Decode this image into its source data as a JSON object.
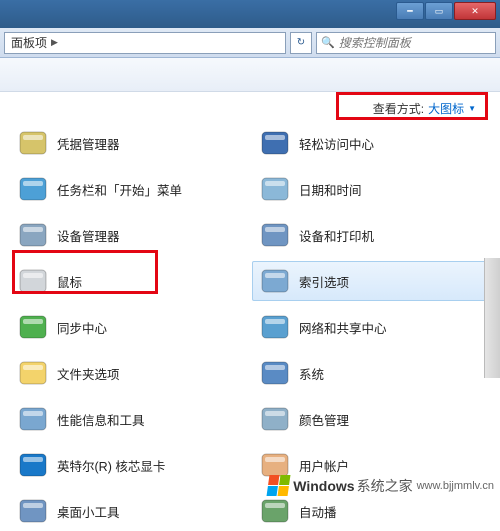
{
  "window": {
    "breadcrumb_text": "面板项",
    "search_placeholder": "搜索控制面板"
  },
  "viewmode": {
    "label": "查看方式:",
    "value": "大图标"
  },
  "items_left": [
    {
      "name": "credential-manager",
      "label": "凭据管理器",
      "icon_bg": "#d6c46a"
    },
    {
      "name": "taskbar-start",
      "label": "任务栏和「开始」菜单",
      "icon_bg": "#4da0d6"
    },
    {
      "name": "device-manager",
      "label": "设备管理器",
      "icon_bg": "#8aa6c0"
    },
    {
      "name": "mouse",
      "label": "鼠标",
      "icon_bg": "#d2d6da"
    },
    {
      "name": "sync-center",
      "label": "同步中心",
      "icon_bg": "#4fb04f"
    },
    {
      "name": "folder-options",
      "label": "文件夹选项",
      "icon_bg": "#f3d36b"
    },
    {
      "name": "perf-tools",
      "label": "性能信息和工具",
      "icon_bg": "#7aa7d0"
    },
    {
      "name": "intel-graphics",
      "label": "英特尔(R) 核芯显卡",
      "icon_bg": "#1978c8"
    },
    {
      "name": "desktop-gadgets",
      "label": "桌面小工具",
      "icon_bg": "#7095c2"
    }
  ],
  "items_right": [
    {
      "name": "ease-of-access",
      "label": "轻松访问中心",
      "icon_bg": "#3f6fb1"
    },
    {
      "name": "date-time",
      "label": "日期和时间",
      "icon_bg": "#8bb8d8"
    },
    {
      "name": "devices-printers",
      "label": "设备和打印机",
      "icon_bg": "#6f95c2"
    },
    {
      "name": "indexing-options",
      "label": "索引选项",
      "icon_bg": "#7ca9d2",
      "selected": true
    },
    {
      "name": "network-sharing",
      "label": "网络和共享中心",
      "icon_bg": "#5aa0d0"
    },
    {
      "name": "system",
      "label": "系统",
      "icon_bg": "#5a8bc4"
    },
    {
      "name": "color-management",
      "label": "颜色管理",
      "icon_bg": "#8fb0c8"
    },
    {
      "name": "user-accounts",
      "label": "用户帐户",
      "icon_bg": "#e7b080"
    },
    {
      "name": "autoplay",
      "label": "自动播",
      "icon_bg": "#6aa36a"
    }
  ],
  "watermark": {
    "brand": "Windows",
    "tagline": "系统之家",
    "url": "www.bjjmmlv.cn"
  }
}
